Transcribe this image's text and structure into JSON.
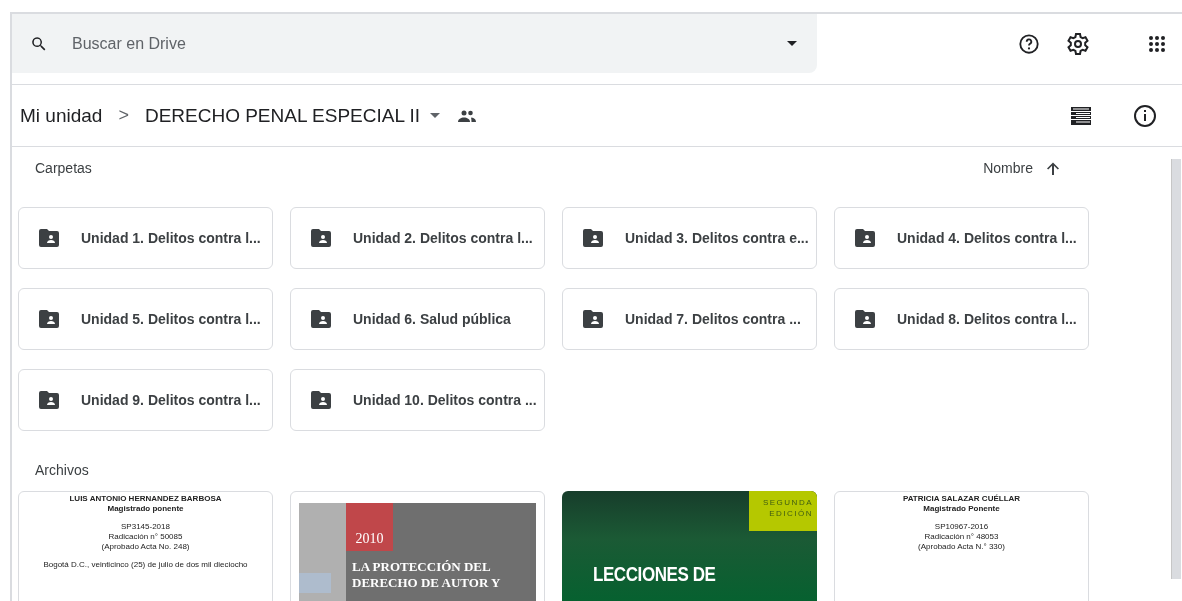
{
  "search": {
    "placeholder": "Buscar en Drive"
  },
  "breadcrumb": {
    "root": "Mi unidad",
    "separator": ">",
    "current": "DERECHO PENAL ESPECIAL II",
    "shared": true
  },
  "folders_section": {
    "title": "Carpetas",
    "sort_label": "Nombre",
    "sort_ascending": true
  },
  "folders": [
    {
      "name": "Unidad 1. Delitos contra l..."
    },
    {
      "name": "Unidad 2. Delitos contra l..."
    },
    {
      "name": "Unidad 3. Delitos contra e..."
    },
    {
      "name": "Unidad 4. Delitos contra l..."
    },
    {
      "name": "Unidad 5. Delitos contra l..."
    },
    {
      "name": "Unidad 6. Salud pública"
    },
    {
      "name": "Unidad 7. Delitos contra ..."
    },
    {
      "name": "Unidad 8. Delitos contra l..."
    },
    {
      "name": "Unidad 9. Delitos contra l..."
    },
    {
      "name": "Unidad 10. Delitos contra ..."
    }
  ],
  "files_section": {
    "title": "Archivos"
  },
  "files": [
    {
      "kind": "document",
      "blocks": [
        [
          "LUIS ANTONIO HERNANDEZ BARBOSA",
          "Magistrado ponente"
        ],
        [
          "SP3145-2018",
          "Radicación n° 50085",
          "(Aprobado Acta No. 248)"
        ],
        [
          "Bogotá D.C., veinticinco (25) de julio de dos mil dieciocho"
        ]
      ]
    },
    {
      "kind": "gray_cover",
      "year": "2010",
      "title_lines": [
        "LA PROTECCIÓN DEL",
        "DERECHO DE AUTOR Y"
      ]
    },
    {
      "kind": "green_cover",
      "edition": "SEGUNDA EDICIÓN",
      "title_lines": [
        "LECCIONES DE"
      ]
    },
    {
      "kind": "document",
      "blocks": [
        [
          "PATRICIA SALAZAR CUÉLLAR",
          "Magistrado Ponente"
        ],
        [
          "SP10967-2016",
          "Radicación n° 48053",
          "(Aprobado Acta N.° 330)"
        ]
      ]
    }
  ]
}
